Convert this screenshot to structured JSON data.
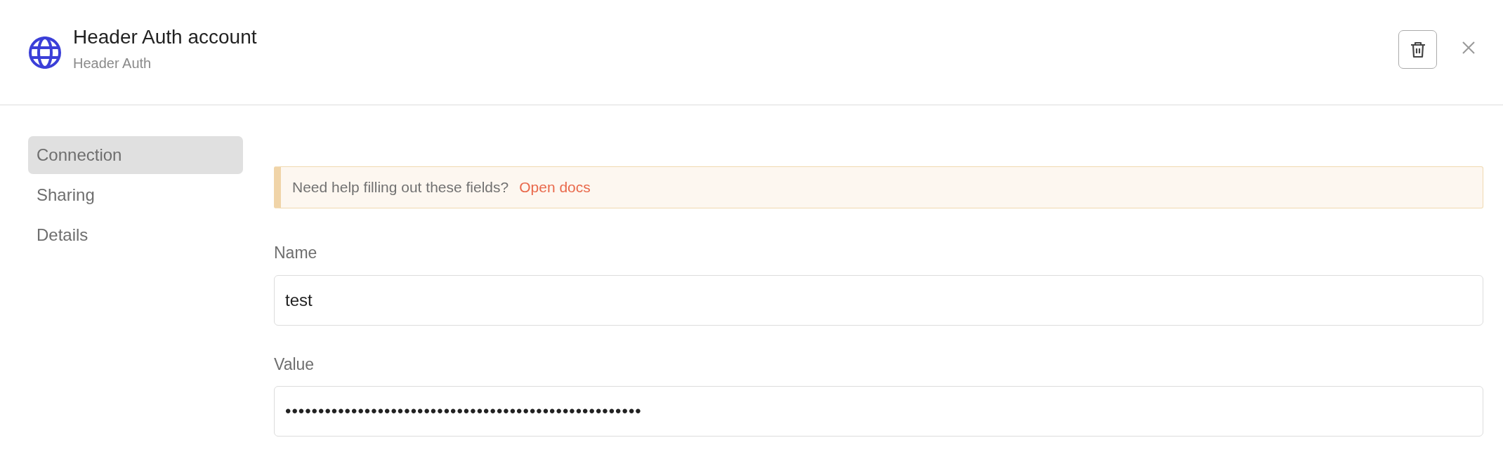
{
  "header": {
    "title": "Header Auth account",
    "subtitle": "Header Auth"
  },
  "sidebar": {
    "items": [
      {
        "label": "Connection",
        "selected": true
      },
      {
        "label": "Sharing",
        "selected": false
      },
      {
        "label": "Details",
        "selected": false
      }
    ]
  },
  "notice": {
    "text": "Need help filling out these fields?",
    "link": "Open docs"
  },
  "fields": [
    {
      "label": "Name",
      "value": "test"
    },
    {
      "label": "Value",
      "value": "••••••••••••••••••••••••••••••••••••••••••••••••••••••"
    }
  ]
}
